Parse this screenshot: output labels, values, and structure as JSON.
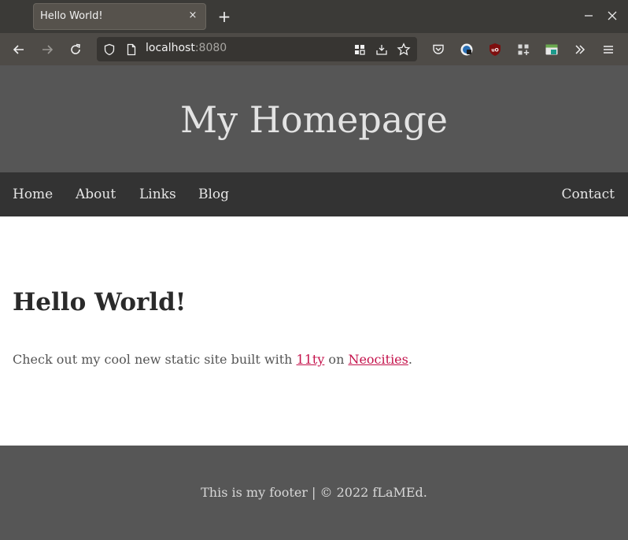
{
  "browser": {
    "tab_title": "Hello World!",
    "tab_close": "×",
    "new_tab": "+",
    "url_host": "localhost",
    "url_port": ":8080",
    "toolbar_icons": [
      "back-arrow-icon",
      "forward-arrow-icon",
      "reload-icon",
      "shield-icon",
      "page-icon",
      "grid-icon",
      "download-icon",
      "star-icon",
      "pocket-icon",
      "privacy-badger-icon",
      "ublock-icon",
      "extensions-icon",
      "container-icon",
      "overflow-icon",
      "menu-icon"
    ]
  },
  "site": {
    "title": "My Homepage",
    "nav": {
      "home": "Home",
      "about": "About",
      "links": "Links",
      "blog": "Blog",
      "contact": "Contact"
    },
    "heading": "Hello World!",
    "intro_before": "Check out my cool new static site built with ",
    "intro_link1": "11ty",
    "intro_middle": " on ",
    "intro_link2": "Neocities",
    "intro_after": ".",
    "footer": "This is my footer | © 2022 fLaMEd."
  },
  "colors": {
    "header_bg": "#565656",
    "nav_bg": "#333333",
    "link": "#c4124b",
    "footer_bg": "#565656"
  }
}
